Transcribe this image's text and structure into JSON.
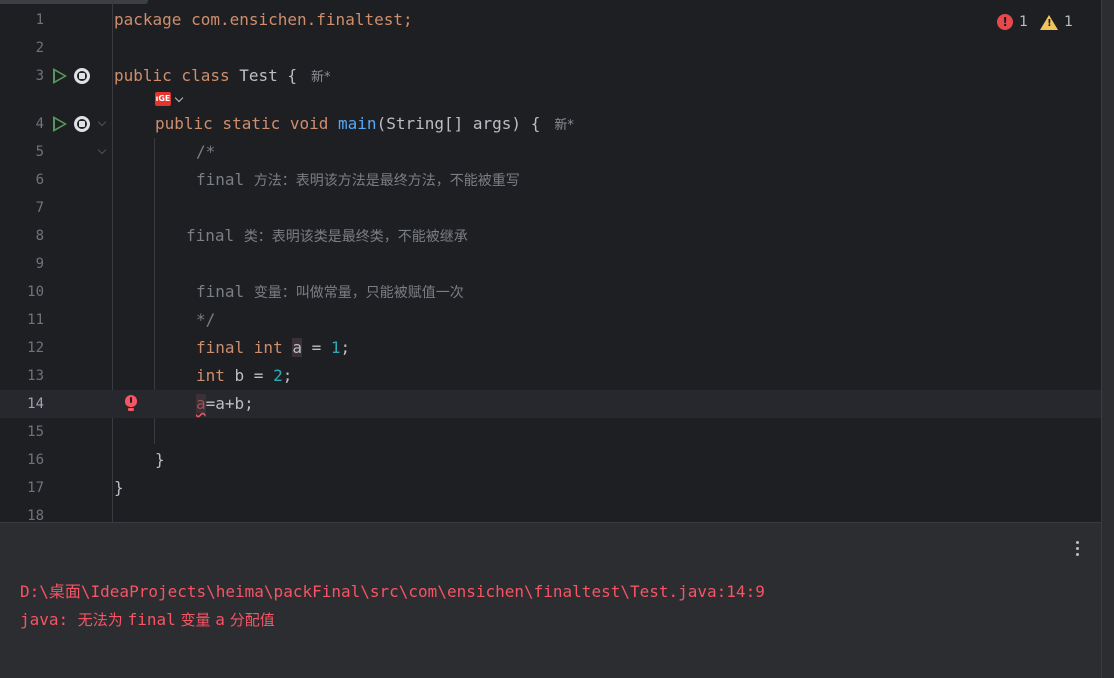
{
  "editor": {
    "inspections": {
      "errors": "1",
      "warnings": "1"
    },
    "hints": {
      "author_hint": "新*"
    },
    "lines": [
      {
        "n": "1",
        "code": "package com.ensichen.finaltest;"
      },
      {
        "n": "2"
      },
      {
        "n": "3",
        "t1": "public class",
        "t2": "Test {"
      },
      {
        "n": "4",
        "t1": "public static void",
        "t2": "main",
        "t3": "(String[] args) {"
      },
      {
        "n": "5",
        "t1": "/*"
      },
      {
        "n": "6",
        "t1": "final",
        "t2": "方法：表明该方法是最终方法，不能被重写"
      },
      {
        "n": "7"
      },
      {
        "n": "8",
        "t1": "final",
        "t2": "类：表明该类是最终类，不能被继承"
      },
      {
        "n": "9"
      },
      {
        "n": "10",
        "t1": "final",
        "t2": "变量：叫做常量，只能被赋值一次"
      },
      {
        "n": "11",
        "t1": "*/"
      },
      {
        "n": "12",
        "t1": "final int",
        "t2": "a",
        "t3": " = ",
        "t4": "1",
        "t5": ";"
      },
      {
        "n": "13",
        "t1": "int",
        "t2": " b = ",
        "t3": "2",
        "t4": ";"
      },
      {
        "n": "14",
        "t1": "a",
        "t2": "=a+b;"
      },
      {
        "n": "15"
      },
      {
        "n": "16",
        "t1": "}"
      },
      {
        "n": "17",
        "t1": "}"
      },
      {
        "n": "18"
      }
    ],
    "ai_badge_label": "ıGE"
  },
  "console": {
    "path_line": "D:\\桌面\\IdeaProjects\\heima\\packFinal\\src\\com\\ensichen\\finaltest\\Test.java:14:9",
    "msg_prefix": "java: ",
    "msg_cn1": "无法为 ",
    "msg_kw": "final",
    "msg_cn2": " 变量 ",
    "msg_var": "a",
    "msg_cn3": " 分配值"
  },
  "colors": {
    "background": "#1e1f22",
    "keyword": "#cf8e6d",
    "function": "#56a8f5",
    "number": "#2aacb8",
    "comment": "#7a7e85",
    "error": "#f75464",
    "run": "#57965c"
  }
}
